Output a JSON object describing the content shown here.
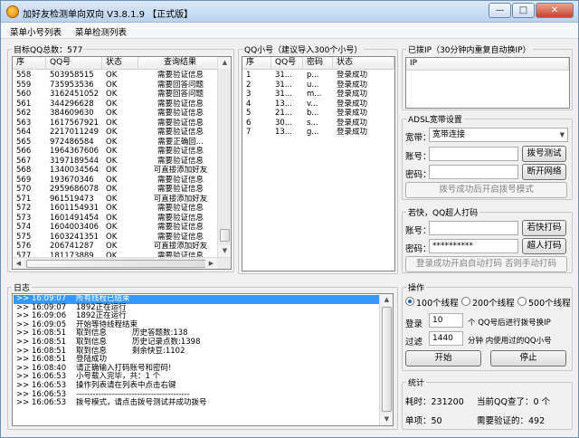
{
  "window": {
    "title": "加好友检测单向双向 V3.8.1.9 【正式版】",
    "min": "—",
    "max": "□",
    "close": "✕"
  },
  "menu": [
    "菜单小号列表",
    "菜单检测列表"
  ],
  "target": {
    "group_title": "目标QQ总数：577",
    "headers": [
      "序",
      "QQ号",
      "状态",
      "查询结果"
    ],
    "rows": [
      [
        "558",
        "503958515",
        "OK",
        "需要验证信息"
      ],
      [
        "559",
        "735953536",
        "OK",
        "需要回答问题"
      ],
      [
        "560",
        "3162451052",
        "OK",
        "需要回答问题"
      ],
      [
        "561",
        "344296628",
        "OK",
        "需要验证信息"
      ],
      [
        "562",
        "384609630",
        "OK",
        "需要验证信息"
      ],
      [
        "563",
        "1617567921",
        "OK",
        "需要验证信息"
      ],
      [
        "564",
        "2217011249",
        "OK",
        "需要验证信息"
      ],
      [
        "565",
        "972486584",
        "OK",
        "需要正确回..."
      ],
      [
        "566",
        "1964367606",
        "OK",
        "需要验证信息"
      ],
      [
        "567",
        "3197189544",
        "OK",
        "需要验证信息"
      ],
      [
        "568",
        "1340034564",
        "OK",
        "可直接添加好友"
      ],
      [
        "569",
        "193670346",
        "OK",
        "需要验证信息"
      ],
      [
        "570",
        "2959686078",
        "OK",
        "需要验证信息"
      ],
      [
        "571",
        "961519473",
        "OK",
        "可直接添加好友"
      ],
      [
        "572",
        "1601154931",
        "OK",
        "需要验证信息"
      ],
      [
        "573",
        "1601491454",
        "OK",
        "需要验证信息"
      ],
      [
        "574",
        "1604003406",
        "OK",
        "需要验证信息"
      ],
      [
        "575",
        "1603241351",
        "OK",
        "需要验证信息"
      ],
      [
        "576",
        "206741287",
        "OK",
        "可直接添加好友"
      ],
      [
        "577",
        "181173889",
        "OK",
        "需要验证信息"
      ]
    ]
  },
  "small": {
    "group_title": "QQ小号（建议导入300个小号）",
    "headers": [
      "序",
      "QQ号",
      "密码",
      "状态"
    ],
    "rows": [
      [
        "1",
        "31...",
        "p...",
        "登录成功"
      ],
      [
        "2",
        "31...",
        "u...",
        "登录成功"
      ],
      [
        "3",
        "31...",
        "m...",
        "登录成功"
      ],
      [
        "4",
        "13...",
        "v...",
        "登录成功"
      ],
      [
        "5",
        "21...",
        "b...",
        "登录成功"
      ],
      [
        "6",
        "30...",
        "s...",
        "登录成功"
      ],
      [
        "7",
        "13...",
        "g...",
        "登录成功"
      ]
    ]
  },
  "ipbox": {
    "group_title": "已拨IP（30分钟内重复自动换IP）",
    "header": "IP"
  },
  "adsl": {
    "group_title": "ADSL宽带设置",
    "bandwidth_label": "宽带：",
    "bandwidth_value": "宽带连接",
    "account_label": "账号：",
    "password_label": "密码：",
    "dial_test": "拨号测试",
    "disconnect": "断开网络",
    "auto_dial": "拨号成功后开启拨号模式"
  },
  "captcha": {
    "group_title": "若快，QQ超人打码",
    "account_label": "账号：",
    "account_value": "",
    "password_label": "密码：",
    "password_value": "**********",
    "btn1": "若快打码",
    "btn2": "超人打码",
    "auto": "登录成功开启自动打码 否则手动打码"
  },
  "log": {
    "group_title": "日志",
    "rows": [
      [
        ">> 16:09:07",
        "所有线程已结束"
      ],
      [
        ">> 16:09:07",
        "1892正在运行"
      ],
      [
        ">> 16:09:06",
        "1892正在运行"
      ],
      [
        ">> 16:09:05",
        "开始等待线程结束"
      ],
      [
        ">> 16:08:51",
        "取到信息",
        "历史答题数:138"
      ],
      [
        ">> 16:08:51",
        "取到信息",
        "历史记录点数:1398"
      ],
      [
        ">> 16:08:51",
        "取到信息",
        "剩余快豆:1102"
      ],
      [
        ">> 16:08:51",
        "登陆成功"
      ],
      [
        ">> 16:08:40",
        "请正确输入打码账号和密码!"
      ],
      [
        ">> 16:06:53",
        "小号载入完毕，共：1 个"
      ],
      [
        ">> 16:06:53",
        "操作列表请在列表中点击右键"
      ],
      [
        ">> 16:06:53",
        "-----------------------------------------"
      ],
      [
        ">> 16:06:53",
        "拨号模式，请点击拨号测试并成功拨号"
      ]
    ]
  },
  "ops": {
    "group_title": "操作",
    "r1": "100个线程",
    "r2": "200个线程",
    "r3": "500个线程",
    "login_label": "登录",
    "login_value": "10",
    "login_suffix": "个  QQ号后进行拨号换IP",
    "filter_label": "过滤",
    "filter_value": "1440",
    "filter_suffix": "分钟 内使用过的QQ小号",
    "start": "开始",
    "stop": "停止"
  },
  "stats": {
    "group_title": "统计",
    "elapsed": "耗时：231200",
    "current": "当前QQ查了：0 个",
    "single": "单项：50",
    "need_verify": "需要验证的：492"
  }
}
